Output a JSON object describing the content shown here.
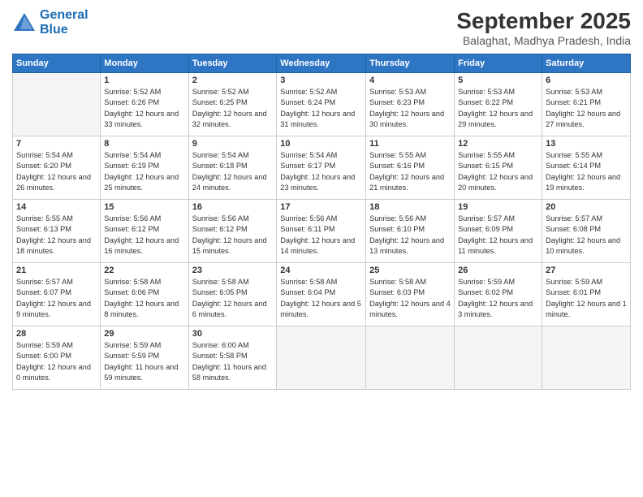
{
  "logo": {
    "line1": "General",
    "line2": "Blue"
  },
  "title": "September 2025",
  "location": "Balaghat, Madhya Pradesh, India",
  "days_header": [
    "Sunday",
    "Monday",
    "Tuesday",
    "Wednesday",
    "Thursday",
    "Friday",
    "Saturday"
  ],
  "weeks": [
    [
      {
        "day": "",
        "empty": true
      },
      {
        "day": "1",
        "sunrise": "5:52 AM",
        "sunset": "6:26 PM",
        "daylight": "12 hours and 33 minutes."
      },
      {
        "day": "2",
        "sunrise": "5:52 AM",
        "sunset": "6:25 PM",
        "daylight": "12 hours and 32 minutes."
      },
      {
        "day": "3",
        "sunrise": "5:52 AM",
        "sunset": "6:24 PM",
        "daylight": "12 hours and 31 minutes."
      },
      {
        "day": "4",
        "sunrise": "5:53 AM",
        "sunset": "6:23 PM",
        "daylight": "12 hours and 30 minutes."
      },
      {
        "day": "5",
        "sunrise": "5:53 AM",
        "sunset": "6:22 PM",
        "daylight": "12 hours and 29 minutes."
      },
      {
        "day": "6",
        "sunrise": "5:53 AM",
        "sunset": "6:21 PM",
        "daylight": "12 hours and 27 minutes."
      }
    ],
    [
      {
        "day": "7",
        "sunrise": "5:54 AM",
        "sunset": "6:20 PM",
        "daylight": "12 hours and 26 minutes."
      },
      {
        "day": "8",
        "sunrise": "5:54 AM",
        "sunset": "6:19 PM",
        "daylight": "12 hours and 25 minutes."
      },
      {
        "day": "9",
        "sunrise": "5:54 AM",
        "sunset": "6:18 PM",
        "daylight": "12 hours and 24 minutes."
      },
      {
        "day": "10",
        "sunrise": "5:54 AM",
        "sunset": "6:17 PM",
        "daylight": "12 hours and 23 minutes."
      },
      {
        "day": "11",
        "sunrise": "5:55 AM",
        "sunset": "6:16 PM",
        "daylight": "12 hours and 21 minutes."
      },
      {
        "day": "12",
        "sunrise": "5:55 AM",
        "sunset": "6:15 PM",
        "daylight": "12 hours and 20 minutes."
      },
      {
        "day": "13",
        "sunrise": "5:55 AM",
        "sunset": "6:14 PM",
        "daylight": "12 hours and 19 minutes."
      }
    ],
    [
      {
        "day": "14",
        "sunrise": "5:55 AM",
        "sunset": "6:13 PM",
        "daylight": "12 hours and 18 minutes."
      },
      {
        "day": "15",
        "sunrise": "5:56 AM",
        "sunset": "6:12 PM",
        "daylight": "12 hours and 16 minutes."
      },
      {
        "day": "16",
        "sunrise": "5:56 AM",
        "sunset": "6:12 PM",
        "daylight": "12 hours and 15 minutes."
      },
      {
        "day": "17",
        "sunrise": "5:56 AM",
        "sunset": "6:11 PM",
        "daylight": "12 hours and 14 minutes."
      },
      {
        "day": "18",
        "sunrise": "5:56 AM",
        "sunset": "6:10 PM",
        "daylight": "12 hours and 13 minutes."
      },
      {
        "day": "19",
        "sunrise": "5:57 AM",
        "sunset": "6:09 PM",
        "daylight": "12 hours and 11 minutes."
      },
      {
        "day": "20",
        "sunrise": "5:57 AM",
        "sunset": "6:08 PM",
        "daylight": "12 hours and 10 minutes."
      }
    ],
    [
      {
        "day": "21",
        "sunrise": "5:57 AM",
        "sunset": "6:07 PM",
        "daylight": "12 hours and 9 minutes."
      },
      {
        "day": "22",
        "sunrise": "5:58 AM",
        "sunset": "6:06 PM",
        "daylight": "12 hours and 8 minutes."
      },
      {
        "day": "23",
        "sunrise": "5:58 AM",
        "sunset": "6:05 PM",
        "daylight": "12 hours and 6 minutes."
      },
      {
        "day": "24",
        "sunrise": "5:58 AM",
        "sunset": "6:04 PM",
        "daylight": "12 hours and 5 minutes."
      },
      {
        "day": "25",
        "sunrise": "5:58 AM",
        "sunset": "6:03 PM",
        "daylight": "12 hours and 4 minutes."
      },
      {
        "day": "26",
        "sunrise": "5:59 AM",
        "sunset": "6:02 PM",
        "daylight": "12 hours and 3 minutes."
      },
      {
        "day": "27",
        "sunrise": "5:59 AM",
        "sunset": "6:01 PM",
        "daylight": "12 hours and 1 minute."
      }
    ],
    [
      {
        "day": "28",
        "sunrise": "5:59 AM",
        "sunset": "6:00 PM",
        "daylight": "12 hours and 0 minutes."
      },
      {
        "day": "29",
        "sunrise": "5:59 AM",
        "sunset": "5:59 PM",
        "daylight": "11 hours and 59 minutes."
      },
      {
        "day": "30",
        "sunrise": "6:00 AM",
        "sunset": "5:58 PM",
        "daylight": "11 hours and 58 minutes."
      },
      {
        "day": "",
        "empty": true
      },
      {
        "day": "",
        "empty": true
      },
      {
        "day": "",
        "empty": true
      },
      {
        "day": "",
        "empty": true
      }
    ]
  ]
}
